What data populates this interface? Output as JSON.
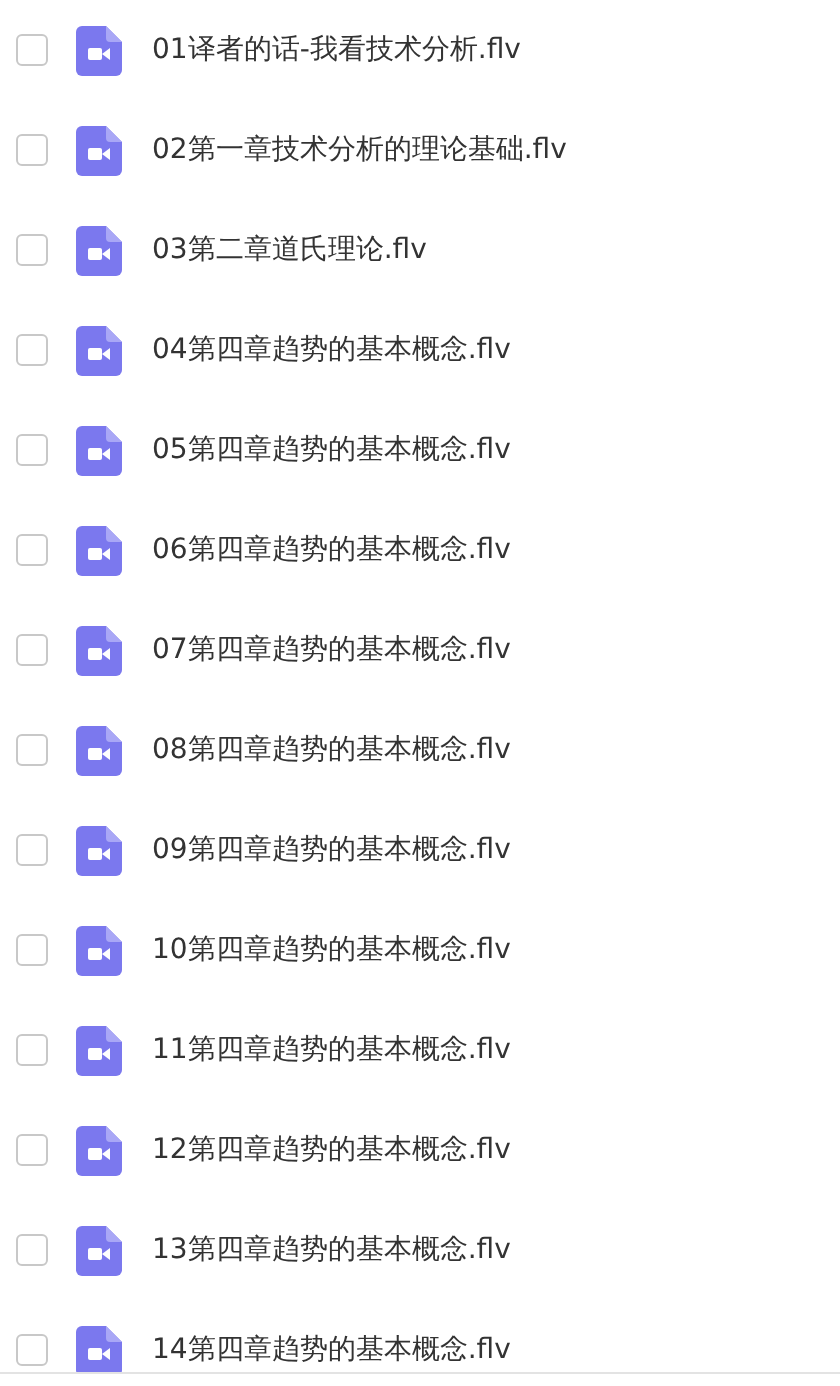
{
  "files": [
    {
      "name": "01译者的话-我看技术分析.flv",
      "checked": false
    },
    {
      "name": "02第一章技术分析的理论基础.flv",
      "checked": false
    },
    {
      "name": "03第二章道氏理论.flv",
      "checked": false
    },
    {
      "name": "04第四章趋势的基本概念.flv",
      "checked": false
    },
    {
      "name": "05第四章趋势的基本概念.flv",
      "checked": false
    },
    {
      "name": "06第四章趋势的基本概念.flv",
      "checked": false
    },
    {
      "name": "07第四章趋势的基本概念.flv",
      "checked": false
    },
    {
      "name": "08第四章趋势的基本概念.flv",
      "checked": false
    },
    {
      "name": "09第四章趋势的基本概念.flv",
      "checked": false
    },
    {
      "name": "10第四章趋势的基本概念.flv",
      "checked": false
    },
    {
      "name": "11第四章趋势的基本概念.flv",
      "checked": false
    },
    {
      "name": "12第四章趋势的基本概念.flv",
      "checked": false
    },
    {
      "name": "13第四章趋势的基本概念.flv",
      "checked": false
    },
    {
      "name": "14第四章趋势的基本概念.flv",
      "checked": false
    }
  ]
}
